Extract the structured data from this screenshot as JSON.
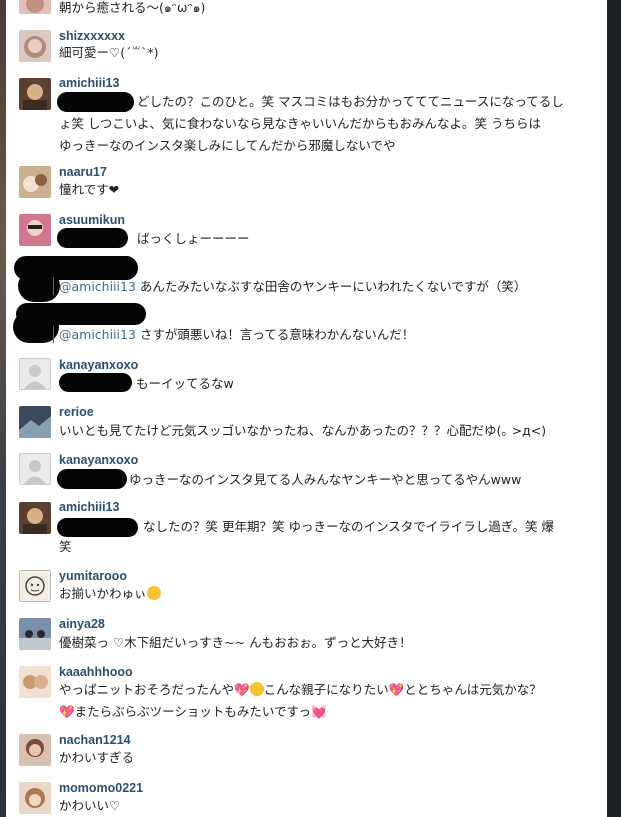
{
  "comments": [
    {
      "id": "c0",
      "username": "",
      "text": "朝から癒される〜(๑ᵔωᵔ๑)"
    },
    {
      "id": "c1",
      "username": "shizxxxxxx",
      "text": "細可愛ー♡(´꒳`*)"
    },
    {
      "id": "c2",
      "username": "amichiii13",
      "line1": "どしたの？このひと。笑 マスコミはもお分かってててニュースになってるし",
      "line2": "ょ笑 しつこいよ、気に食わないなら見なきゃいいんだからもおみんなよ。笑 うちらは",
      "line3": "ゆっきーなのインスタ楽しみにしてんだから邪魔しないでや"
    },
    {
      "id": "c3",
      "username": "naaru17",
      "text": "憧れです❤"
    },
    {
      "id": "c4",
      "username": "asuumikun",
      "text": "ばっくしょーーーー"
    },
    {
      "id": "c5",
      "mention": "@amichiii13",
      "text": "あんたみたいなぶすな田舎のヤンキーにいわれたくないですが（笑）"
    },
    {
      "id": "c6",
      "mention": "@amichiii13",
      "text": "さすが頭悪いね！言ってる意味わかんないんだ！"
    },
    {
      "id": "c7",
      "username": "kanayanxoxo",
      "text": "もーイッてるなw"
    },
    {
      "id": "c8",
      "username": "rerioe",
      "text": "いいとも見てたけど元気スッゴいなかったね、なんかあったの？？？心配だゆ(｡ >д<)"
    },
    {
      "id": "c9",
      "username": "kanayanxoxo",
      "text": "ゆっきーなのインスタ見てる人みんなヤンキーやと思ってるやんwww"
    },
    {
      "id": "c10",
      "username": "amichiii13",
      "line1": "なしたの？笑 更年期？笑 ゆっきーなのインスタでイライラし過ぎ。笑 爆",
      "line2": "笑"
    },
    {
      "id": "c11",
      "username": "yumitarooo",
      "text": "お揃いかわゅぃ"
    },
    {
      "id": "c12",
      "username": "ainya28",
      "text": "優樹菜っ ♡木下組だいっすき~~ んもおおぉ。ずっと大好き！"
    },
    {
      "id": "c13",
      "username": "kaaahhhooo",
      "line1a": "やっぱニットおそろだったんや",
      "line1b": "こんな親子になりたい",
      "line1c": "ととちゃんは元気かな？",
      "line2": "またらぶらぶツーショットもみたいですっ"
    },
    {
      "id": "c14",
      "username": "nachan1214",
      "text": "かわいすぎる"
    },
    {
      "id": "c15",
      "username": "momomo0221",
      "text": "かわいい♡"
    }
  ],
  "icons": {
    "avatar": "user-avatar-icon",
    "default_avatar": "default-avatar-icon",
    "heart_emoji": "pink-heart-icon",
    "smile_emoji": "smile-icon"
  },
  "colors": {
    "username": "#2d4e6e",
    "mention": "#3f6b94",
    "text": "#1f1f1f",
    "redacted": "#050505"
  }
}
